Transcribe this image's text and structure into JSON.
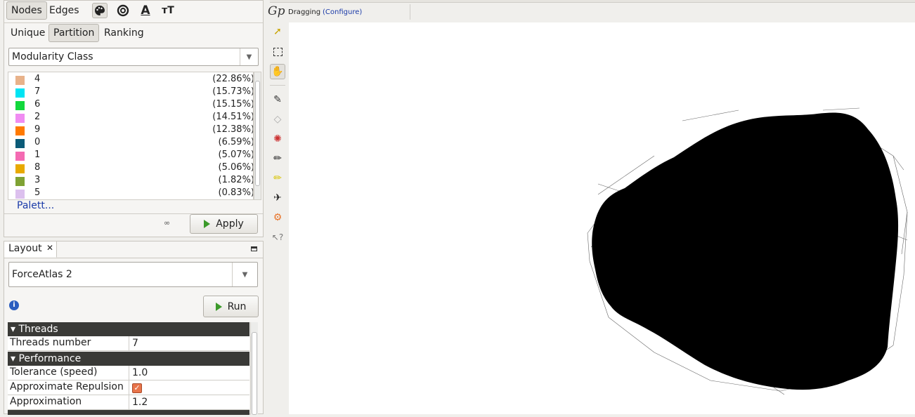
{
  "appearance": {
    "tabs": [
      "Nodes",
      "Edges"
    ],
    "sub_tabs": [
      "Unique",
      "Partition",
      "Ranking"
    ],
    "attribute": "Modularity Class",
    "partition_items": [
      {
        "label": "4",
        "pct": "(22.86%)",
        "color": "#e8b28a"
      },
      {
        "label": "7",
        "pct": "(15.73%)",
        "color": "#00e4f4"
      },
      {
        "label": "6",
        "pct": "(15.15%)",
        "color": "#12d83c"
      },
      {
        "label": "2",
        "pct": "(14.51%)",
        "color": "#f08cf2"
      },
      {
        "label": "9",
        "pct": "(12.38%)",
        "color": "#ff7a00"
      },
      {
        "label": "0",
        "pct": "(6.59%)",
        "color": "#0b5b78"
      },
      {
        "label": "1",
        "pct": "(5.07%)",
        "color": "#f46ab2"
      },
      {
        "label": "8",
        "pct": "(5.06%)",
        "color": "#e8a900"
      },
      {
        "label": "3",
        "pct": "(1.82%)",
        "color": "#7fa234"
      },
      {
        "label": "5",
        "pct": "(0.83%)",
        "color": "#dcc0ee"
      }
    ],
    "palette_link": "Palett...",
    "apply_label": "Apply"
  },
  "layout": {
    "tab_title": "Layout",
    "algorithm": "ForceAtlas 2",
    "run_label": "Run",
    "sections": [
      {
        "title": "Threads",
        "props": [
          {
            "key": "Threads number",
            "value": "7"
          }
        ]
      },
      {
        "title": "Performance",
        "props": [
          {
            "key": "Tolerance (speed)",
            "value": "1.0"
          },
          {
            "key": "Approximate Repulsion",
            "value": "",
            "checked": true
          },
          {
            "key": "Approximation",
            "value": "1.2"
          }
        ]
      }
    ]
  },
  "graph_toolbar": {
    "mode": "Dragging",
    "configure": "(Configure)",
    "logo": "Gp"
  }
}
